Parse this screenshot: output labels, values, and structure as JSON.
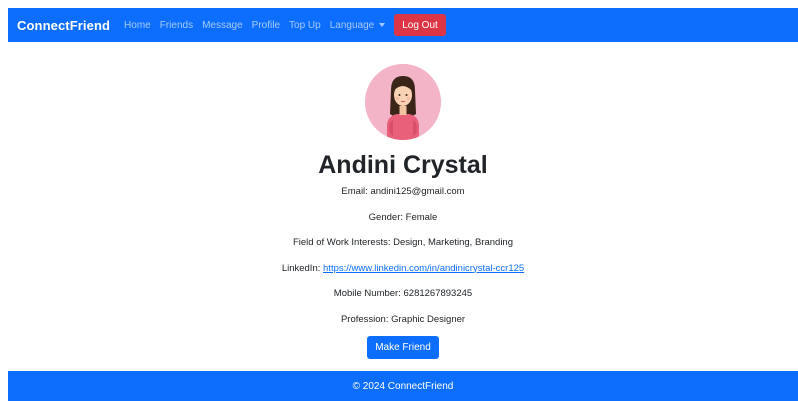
{
  "navbar": {
    "brand": "ConnectFriend",
    "links": [
      "Home",
      "Friends",
      "Message",
      "Profile",
      "Top Up"
    ],
    "language_label": "Language",
    "logout_label": "Log Out"
  },
  "profile": {
    "name": "Andini Crystal",
    "email_label": "Email: ",
    "email": "andini125@gmail.com",
    "gender_label": "Gender: ",
    "gender": "Female",
    "interests_label": "Field of Work Interests: ",
    "interests": "Design, Marketing, Branding",
    "linkedin_label": "LinkedIn: ",
    "linkedin": "https://www.linkedin.com/in/andinicrystal-ccr125",
    "mobile_label": "Mobile Number: ",
    "mobile": "6281267893245",
    "profession_label": "Profession: ",
    "profession": "Graphic Designer",
    "make_friend_label": "Make Friend"
  },
  "footer": {
    "text": "© 2024 ConnectFriend"
  },
  "colors": {
    "primary": "#0d6efd",
    "danger": "#dc3545",
    "avatar_bg": "#f4b4c8"
  }
}
